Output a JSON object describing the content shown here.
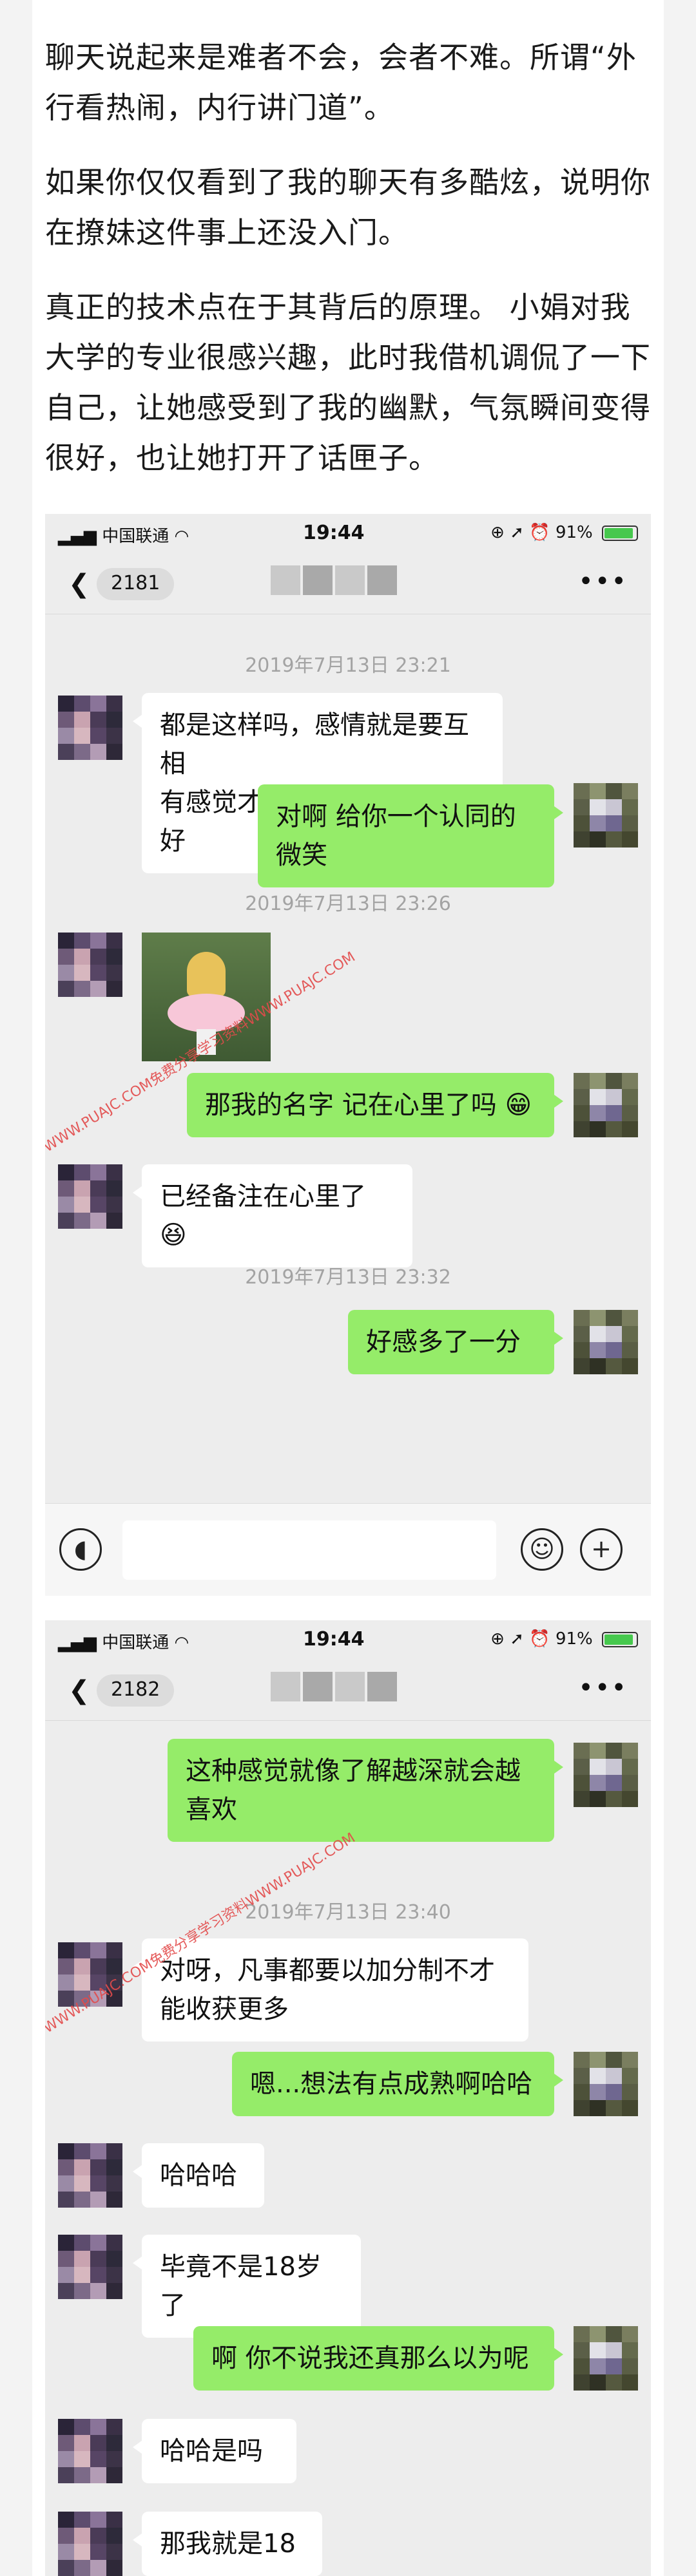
{
  "article": {
    "paragraphs": [
      "聊天说起来是难者不会，会者不难。所谓“外行看热闹，内行讲门道”。",
      "如果你仅仅看到了我的聊天有多酷炫，说明你在撩妹这件事上还没入门。",
      "真正的技术点在于其背后的原理。 小娟对我大学的专业很感兴趣，此时我借机调侃了一下自己，让她感受到了我的幽默，气氛瞬间变得很好，也让她打开了话匣子。"
    ]
  },
  "status_bar": {
    "carrier": "中国联通",
    "time": "19:44",
    "battery": "91%",
    "battery_level": 0.91
  },
  "screens": [
    {
      "unread_count": "2181",
      "timestamps": [
        "2019年7月13日 23:21",
        "2019年7月13日 23:26",
        "2019年7月13日 23:32"
      ],
      "messages": [
        "都是这样吗，感情就是要互相",
        "有感觉才能做到彼此对放都好",
        "对啊 给你一个认同的微笑",
        "那我的名字 记在心里了吗",
        "已经备注在心里了",
        "好感多了一分"
      ]
    },
    {
      "unread_count": "2182",
      "timestamps": [
        "2019年7月13日 23:40"
      ],
      "messages": [
        "这种感觉就像了解越深就会越",
        "喜欢",
        "对呀，凡事都要以加分制不才",
        "能收获更多",
        "嗯...想法有点成熟啊哈哈",
        "哈哈哈",
        "毕竟不是18岁了",
        "啊 你不说我还真那么以为呢",
        "哈哈是吗",
        "那我就是18"
      ]
    }
  ],
  "watermark": "WWW.PUAJC.COM免费分享学习资料WWW.PUAJC.COM",
  "icons": {
    "back": "chevron-left-icon",
    "more": "more-dots-icon",
    "voice": "voice-icon",
    "emoji": "emoji-icon",
    "add": "add-circle-icon"
  },
  "colors": {
    "chat_background": "#ededed",
    "outgoing_bubble": "#95ec69",
    "incoming_bubble": "#ffffff",
    "timestamp_text": "#a3a3a3",
    "battery_green": "#46c84d",
    "watermark_red": "#e34b4b"
  }
}
